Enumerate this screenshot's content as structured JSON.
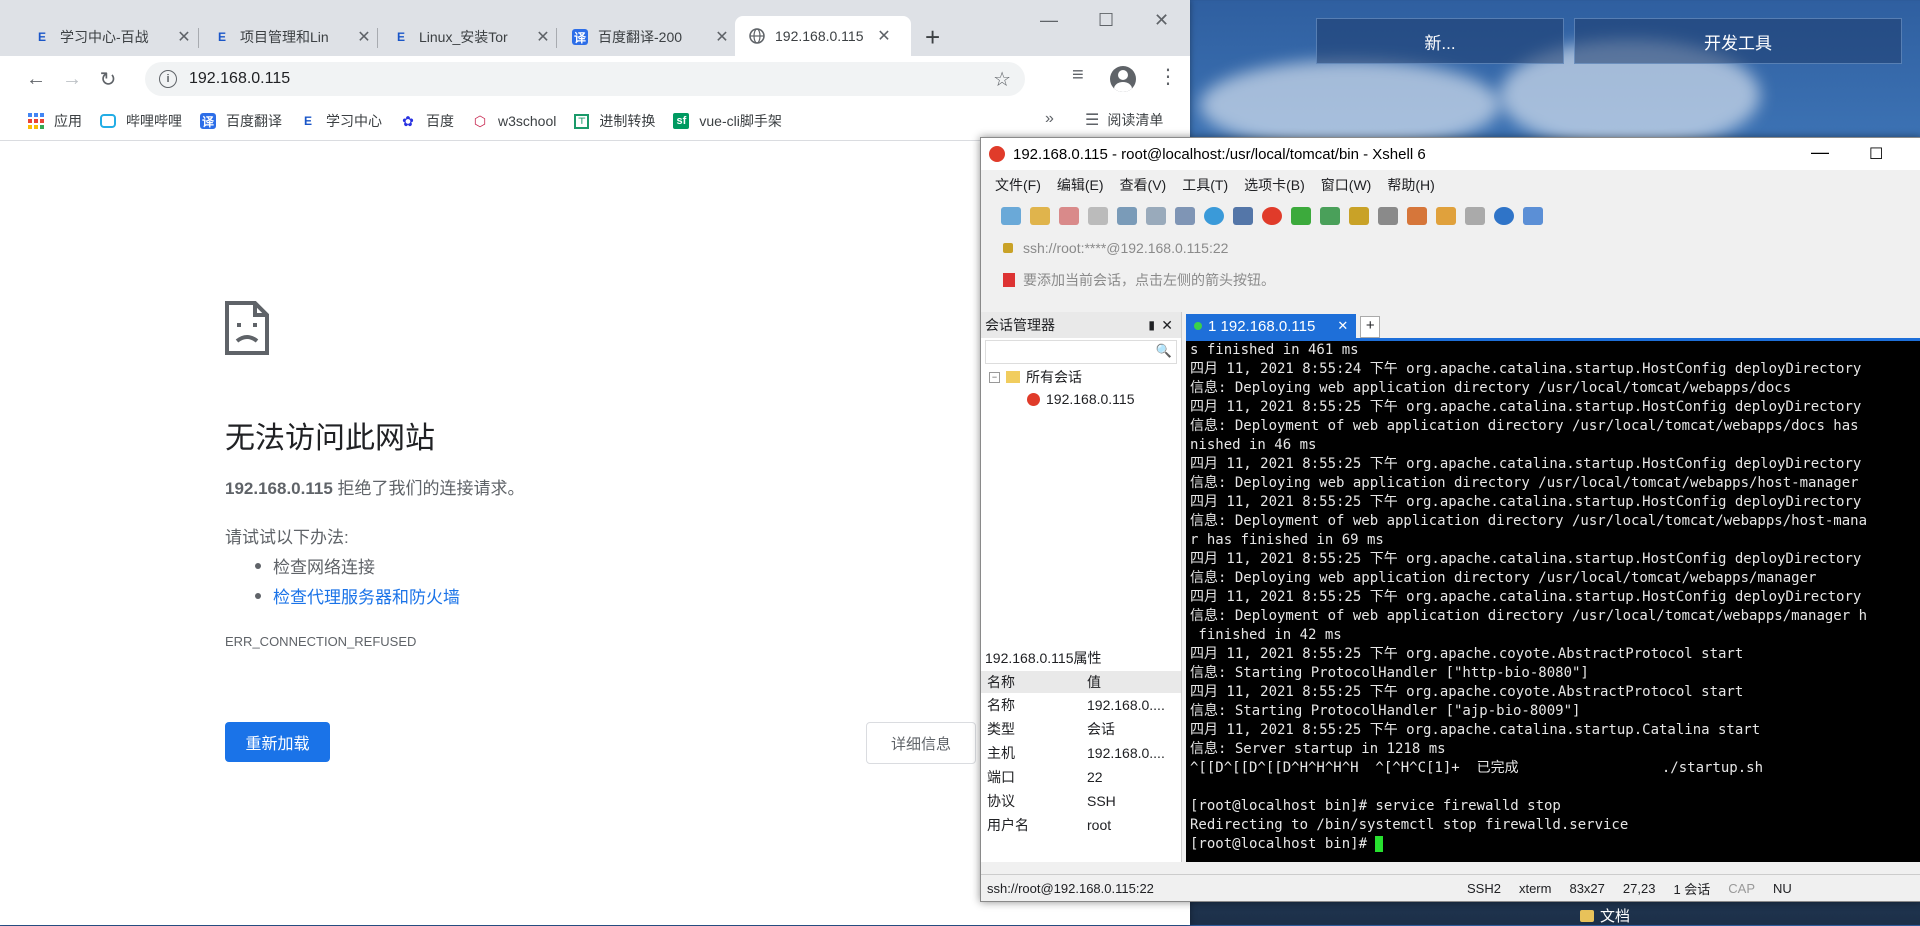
{
  "desktop": {
    "new_button": "新...",
    "devtools_button": "开发工具",
    "file_label": "文档"
  },
  "chrome": {
    "tabs": [
      {
        "title": "学习中心-百战"
      },
      {
        "title": "项目管理和Lin"
      },
      {
        "title": "Linux_安装Tor"
      },
      {
        "title": "百度翻译-200"
      },
      {
        "title": "192.168.0.115"
      }
    ],
    "url": "192.168.0.115",
    "bookmarks": [
      {
        "label": "应用",
        "icon": "apps-grid-icon",
        "color": "#4285f4"
      },
      {
        "label": "哔哩哔哩",
        "icon": "bilibili-icon",
        "color": "#23ade5"
      },
      {
        "label": "百度翻译",
        "icon": "baidu-translate-icon",
        "color": "#2d6ee8"
      },
      {
        "label": "学习中心",
        "icon": "study-center-icon",
        "color": "#1a56c8"
      },
      {
        "label": "百度",
        "icon": "baidu-paw-icon",
        "color": "#2932e1"
      },
      {
        "label": "w3school",
        "icon": "w3school-icon",
        "color": "#c7254e"
      },
      {
        "label": "进制转换",
        "icon": "converter-icon",
        "color": "#1a9a6a"
      },
      {
        "label": "vue-cli脚手架",
        "icon": "sf-icon",
        "color": "#009a61"
      }
    ],
    "more": "»",
    "reading_list": "阅读清单",
    "error": {
      "title": "无法访问此网站",
      "host": "192.168.0.115",
      "message": " 拒绝了我们的连接请求。",
      "try_label": "请试试以下办法:",
      "suggestions": [
        "检查网络连接",
        "检查代理服务器和防火墙"
      ],
      "code": "ERR_CONNECTION_REFUSED",
      "reload": "重新加载",
      "details": "详细信息"
    }
  },
  "xshell": {
    "title": "192.168.0.115 - root@localhost:/usr/local/tomcat/bin - Xshell 6",
    "menu": [
      "文件(F)",
      "编辑(E)",
      "查看(V)",
      "工具(T)",
      "选项卡(B)",
      "窗口(W)",
      "帮助(H)"
    ],
    "address": "ssh://root:****@192.168.0.115:22",
    "hint": "要添加当前会话，点击左侧的箭头按钮。",
    "session_manager": "会话管理器",
    "tree_root": "所有会话",
    "tree_session": "192.168.0.115",
    "props_title": "192.168.0.115属性",
    "props_headers": [
      "名称",
      "值"
    ],
    "props": [
      {
        "k": "名称",
        "v": "192.168.0...."
      },
      {
        "k": "类型",
        "v": "会话"
      },
      {
        "k": "主机",
        "v": "192.168.0...."
      },
      {
        "k": "端口",
        "v": "22"
      },
      {
        "k": "协议",
        "v": "SSH"
      },
      {
        "k": "用户名",
        "v": "root"
      }
    ],
    "tab_label": "1 192.168.0.115",
    "terminal_lines": [
      "s finished in 461 ms",
      "四月 11, 2021 8:55:24 下午 org.apache.catalina.startup.HostConfig deployDirectory",
      "信息: Deploying web application directory /usr/local/tomcat/webapps/docs",
      "四月 11, 2021 8:55:25 下午 org.apache.catalina.startup.HostConfig deployDirectory",
      "信息: Deployment of web application directory /usr/local/tomcat/webapps/docs has",
      "nished in 46 ms",
      "四月 11, 2021 8:55:25 下午 org.apache.catalina.startup.HostConfig deployDirectory",
      "信息: Deploying web application directory /usr/local/tomcat/webapps/host-manager",
      "四月 11, 2021 8:55:25 下午 org.apache.catalina.startup.HostConfig deployDirectory",
      "信息: Deployment of web application directory /usr/local/tomcat/webapps/host-mana",
      "r has finished in 69 ms",
      "四月 11, 2021 8:55:25 下午 org.apache.catalina.startup.HostConfig deployDirectory",
      "信息: Deploying web application directory /usr/local/tomcat/webapps/manager",
      "四月 11, 2021 8:55:25 下午 org.apache.catalina.startup.HostConfig deployDirectory",
      "信息: Deployment of web application directory /usr/local/tomcat/webapps/manager h",
      " finished in 42 ms",
      "四月 11, 2021 8:55:25 下午 org.apache.coyote.AbstractProtocol start",
      "信息: Starting ProtocolHandler [\"http-bio-8080\"]",
      "四月 11, 2021 8:55:25 下午 org.apache.coyote.AbstractProtocol start",
      "信息: Starting ProtocolHandler [\"ajp-bio-8009\"]",
      "四月 11, 2021 8:55:25 下午 org.apache.catalina.startup.Catalina start",
      "信息: Server startup in 1218 ms",
      "^[[D^[[D^[[D^H^H^H^H  ^[^H^C[1]+  已完成                 ./startup.sh",
      "",
      "[root@localhost bin]# service firewalld stop",
      "Redirecting to /bin/systemctl stop firewalld.service",
      "[root@localhost bin]# "
    ],
    "status": {
      "path": "ssh://root@192.168.0.115:22",
      "protocol": "SSH2",
      "term": "xterm",
      "size": "83x27",
      "pos": "27,23",
      "sessions": "1 会话",
      "cap": "CAP",
      "num": "NU"
    }
  }
}
